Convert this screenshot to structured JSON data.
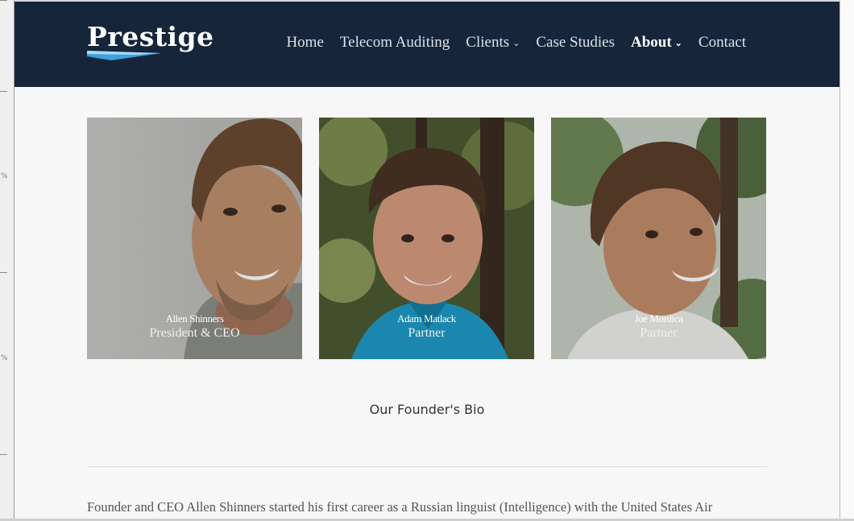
{
  "ruler": {
    "marks": [
      "%",
      "%"
    ]
  },
  "header": {
    "logo_text": "Prestige",
    "nav": [
      {
        "label": "Home",
        "has_dropdown": false,
        "active": false
      },
      {
        "label": "Telecom Auditing",
        "has_dropdown": false,
        "active": false
      },
      {
        "label": "Clients",
        "has_dropdown": true,
        "active": false
      },
      {
        "label": "Case Studies",
        "has_dropdown": false,
        "active": false
      },
      {
        "label": "About",
        "has_dropdown": true,
        "active": true
      },
      {
        "label": "Contact",
        "has_dropdown": false,
        "active": false
      }
    ],
    "chevron_glyph": "⌄"
  },
  "team": [
    {
      "name": "Allen Shinners",
      "role": "President & CEO"
    },
    {
      "name": "Adam Matlack",
      "role": "Partner"
    },
    {
      "name": "Joe Mordica",
      "role": "Partner"
    }
  ],
  "bio": {
    "title": "Our Founder's Bio",
    "text": "Founder and CEO Allen Shinners started his first career as a Russian linguist (Intelligence) with the United States Air"
  },
  "colors": {
    "header_bg": "#16253a",
    "page_bg": "#f7f7f7",
    "logo_swoosh": "#3ea1dd"
  }
}
